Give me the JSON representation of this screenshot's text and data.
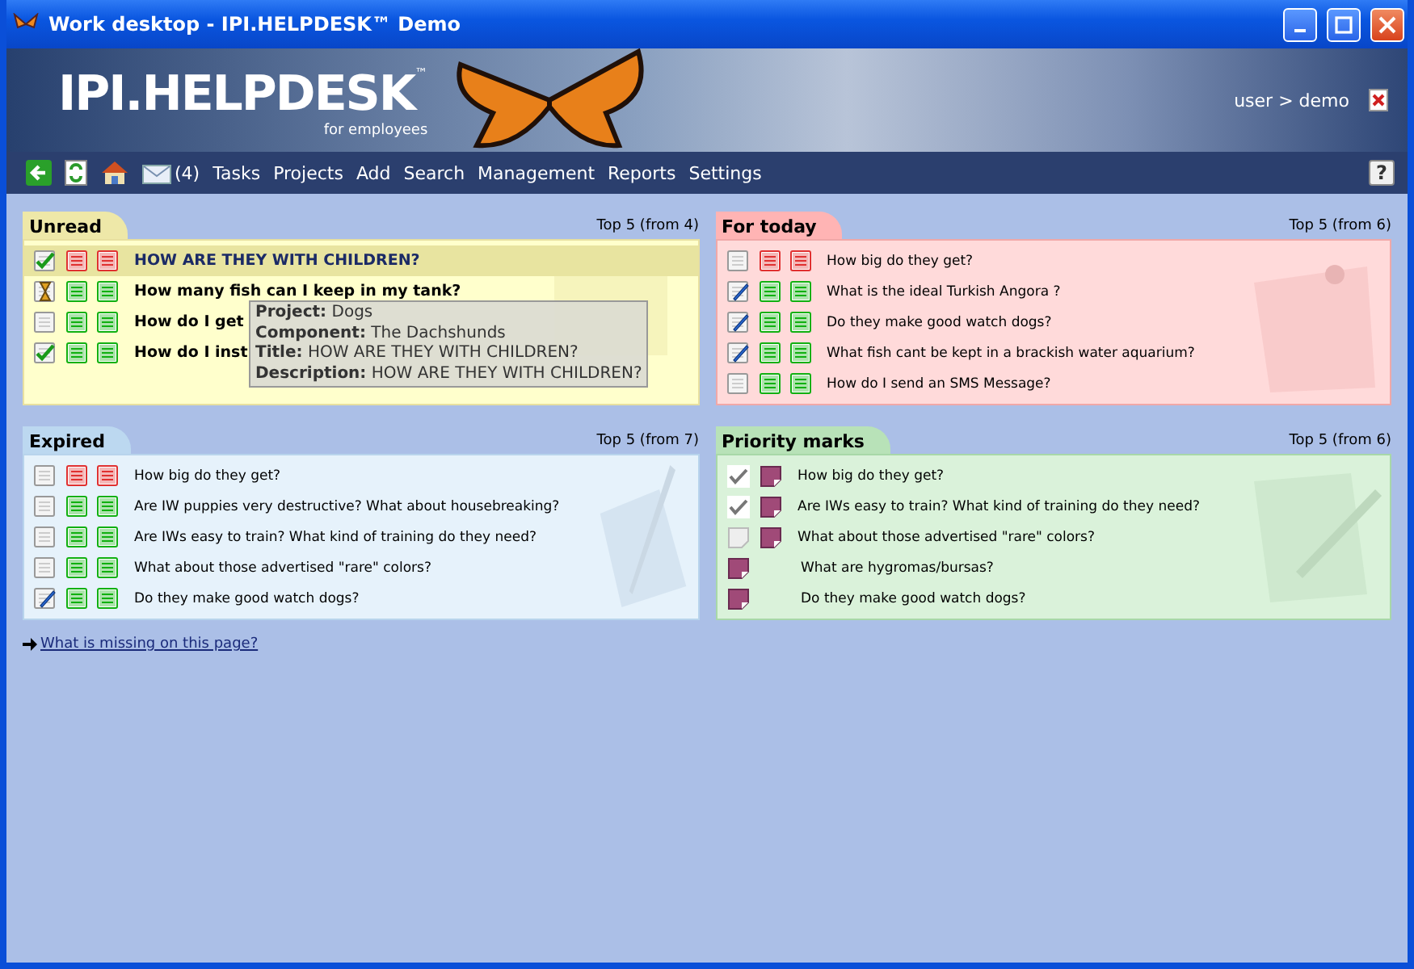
{
  "window": {
    "title": "Work desktop - IPI.HELPDESK™ Demo"
  },
  "banner": {
    "logo": "IPI.HELPDESK",
    "trademark": "™",
    "subtitle": "for employees",
    "user_label": "user",
    "separator": ">",
    "user_name": "demo"
  },
  "nav": {
    "mail_count": "(4)",
    "items": [
      "Tasks",
      "Projects",
      "Add",
      "Search",
      "Management",
      "Reports",
      "Settings"
    ],
    "help": "?"
  },
  "panels": [
    {
      "kind": "unread",
      "title": "Unread",
      "summary": "Top 5 (from 4)",
      "rows": [
        {
          "kind": "checked",
          "icons": [
            {
              "color": "#e03030"
            },
            {
              "color": "#e03030"
            }
          ],
          "text": "HOW ARE THEY WITH CHILDREN?",
          "selected": true
        },
        {
          "kind": "hourglass",
          "icons": [
            {
              "color": "#10b010"
            },
            {
              "color": "#10b010"
            }
          ],
          "text": "How many fish can I keep in my tank?",
          "selected": false
        },
        {
          "kind": "empty",
          "icons": [
            {
              "color": "#10b010"
            },
            {
              "color": "#10b010"
            }
          ],
          "text": "How do I get",
          "selected": false
        },
        {
          "kind": "checked",
          "icons": [
            {
              "color": "#10b010"
            },
            {
              "color": "#10b010"
            }
          ],
          "text": "How do I inst",
          "selected": false
        }
      ],
      "tooltip": [
        {
          "label": "Project:",
          "value": "Dogs"
        },
        {
          "label": "Component:",
          "value": "The Dachshunds"
        },
        {
          "label": "Title:",
          "value": "HOW ARE THEY WITH CHILDREN?"
        },
        {
          "label": "Description:",
          "value": "HOW ARE THEY WITH CHILDREN?"
        }
      ]
    },
    {
      "kind": "today",
      "title": "For today",
      "summary": "Top 5 (from 6)",
      "rows": [
        {
          "kind": "empty",
          "icons": [
            {
              "color": "#e03030"
            },
            {
              "color": "#e03030"
            }
          ],
          "text": "How big do they get?",
          "selected": false
        },
        {
          "kind": "pencil",
          "icons": [
            {
              "color": "#10b010"
            },
            {
              "color": "#10b010"
            }
          ],
          "text": "What is the ideal Turkish Angora ?",
          "selected": false
        },
        {
          "kind": "pencil",
          "icons": [
            {
              "color": "#10b010"
            },
            {
              "color": "#10b010"
            }
          ],
          "text": "Do they make good watch dogs?",
          "selected": false
        },
        {
          "kind": "pencil",
          "icons": [
            {
              "color": "#10b010"
            },
            {
              "color": "#10b010"
            }
          ],
          "text": "What fish cant be kept in a brackish water aquarium?",
          "selected": false
        },
        {
          "kind": "empty",
          "icons": [
            {
              "color": "#10b010"
            },
            {
              "color": "#10b010"
            }
          ],
          "text": "How do I send an SMS Message?",
          "selected": false
        }
      ]
    },
    {
      "kind": "expired",
      "title": "Expired",
      "summary": "Top 5 (from 7)",
      "rows": [
        {
          "kind": "empty",
          "icons": [
            {
              "color": "#e03030"
            },
            {
              "color": "#e03030"
            }
          ],
          "text": "How big do they get?",
          "selected": false
        },
        {
          "kind": "empty",
          "icons": [
            {
              "color": "#10b010"
            },
            {
              "color": "#10b010"
            }
          ],
          "text": "Are IW puppies very destructive? What about housebreaking?",
          "selected": false
        },
        {
          "kind": "empty",
          "icons": [
            {
              "color": "#10b010"
            },
            {
              "color": "#10b010"
            }
          ],
          "text": "Are IWs easy to train? What kind of training do they need?",
          "selected": false
        },
        {
          "kind": "empty",
          "icons": [
            {
              "color": "#10b010"
            },
            {
              "color": "#10b010"
            }
          ],
          "text": "What about those advertised \"rare\" colors?",
          "selected": false
        },
        {
          "kind": "pencil",
          "icons": [
            {
              "color": "#10b010"
            },
            {
              "color": "#10b010"
            }
          ],
          "text": "Do they make good watch dogs?",
          "selected": false
        }
      ]
    },
    {
      "kind": "priority",
      "title": "Priority marks",
      "summary": "Top 5 (from 6)",
      "rows": [
        {
          "marks": [
            {
              "kind": "check"
            },
            {
              "kind": "flag"
            }
          ],
          "text": "How big do they get?",
          "selected": false
        },
        {
          "marks": [
            {
              "kind": "check"
            },
            {
              "kind": "flag"
            }
          ],
          "text": "Are IWs easy to train? What kind of training do they need?",
          "selected": false
        },
        {
          "marks": [
            {
              "kind": "note"
            },
            {
              "kind": "flag"
            }
          ],
          "text": "What about those advertised \"rare\" colors?",
          "selected": false
        },
        {
          "marks": [
            {
              "kind": "flag"
            }
          ],
          "text": "What are hygromas/bursas?",
          "selected": false
        },
        {
          "marks": [
            {
              "kind": "flag"
            }
          ],
          "text": "Do they make good watch dogs?",
          "selected": false
        }
      ]
    }
  ],
  "footer_link": "What is missing on this page?"
}
